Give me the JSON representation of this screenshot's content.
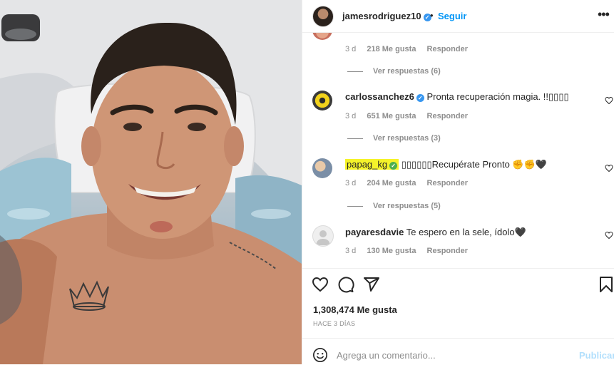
{
  "header": {
    "username": "jamesrodriguez10",
    "separator": "•",
    "follow_label": "Seguir",
    "more_label": "•••"
  },
  "comments": [
    {
      "username": "",
      "text": "",
      "age": "3 d",
      "likes": "218 Me gusta",
      "reply_label": "Responder",
      "view_replies": "Ver respuestas (6)"
    },
    {
      "username": "carlossanchez6",
      "verified": true,
      "text": "Pronta recuperación magia. !!▯▯▯▯",
      "age": "3 d",
      "likes": "651 Me gusta",
      "reply_label": "Responder",
      "view_replies": "Ver respuestas (3)"
    },
    {
      "username": "papag_kg",
      "verified": true,
      "highlighted": true,
      "text": "▯▯▯▯▯▯Recupérate Pronto ✊✊🖤",
      "age": "3 d",
      "likes": "204 Me gusta",
      "reply_label": "Responder",
      "view_replies": "Ver respuestas (5)"
    },
    {
      "username": "payaresdavie",
      "text": "Te espero en la sele, ídolo🖤",
      "age": "3 d",
      "likes": "130 Me gusta",
      "reply_label": "Responder"
    }
  ],
  "post": {
    "likes_count": "1,308,474 Me gusta",
    "time_ago": "HACE 3 DÍAS"
  },
  "composer": {
    "placeholder": "Agrega un comentario...",
    "publish_label": "Publicar"
  },
  "colors": {
    "accent": "#0095f6",
    "verified": "#3897f0",
    "muted_text": "#8e8e8e",
    "highlight": "#f5f32a",
    "publish_disabled": "#b2dffc"
  },
  "icons": [
    "heart-icon",
    "comment-icon",
    "share-icon",
    "bookmark-icon",
    "emoji-icon",
    "more-options-icon",
    "verified-badge-icon"
  ]
}
